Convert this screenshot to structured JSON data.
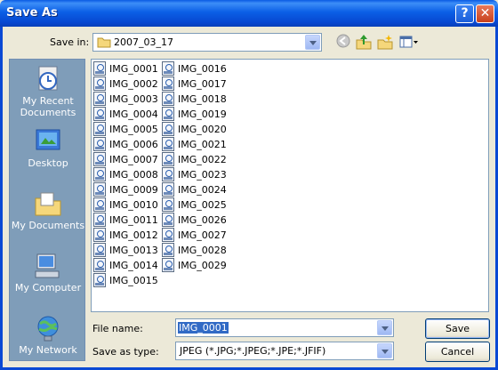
{
  "window": {
    "title": "Save As",
    "help_label": "?",
    "close_label": "✕"
  },
  "save_in": {
    "label": "Save in:",
    "value": "2007_03_17"
  },
  "places": [
    {
      "id": "recent",
      "label": "My Recent Documents"
    },
    {
      "id": "desktop",
      "label": "Desktop"
    },
    {
      "id": "documents",
      "label": "My Documents"
    },
    {
      "id": "computer",
      "label": "My Computer"
    },
    {
      "id": "network",
      "label": "My Network"
    }
  ],
  "files": {
    "column1": [
      "IMG_0001",
      "IMG_0002",
      "IMG_0003",
      "IMG_0004",
      "IMG_0005",
      "IMG_0006",
      "IMG_0007",
      "IMG_0008",
      "IMG_0009",
      "IMG_0010",
      "IMG_0011",
      "IMG_0012",
      "IMG_0013",
      "IMG_0014",
      "IMG_0015"
    ],
    "column2": [
      "IMG_0016",
      "IMG_0017",
      "IMG_0018",
      "IMG_0019",
      "IMG_0020",
      "IMG_0021",
      "IMG_0022",
      "IMG_0023",
      "IMG_0024",
      "IMG_0025",
      "IMG_0026",
      "IMG_0027",
      "IMG_0028",
      "IMG_0029"
    ]
  },
  "file_name": {
    "label": "File name:",
    "value": "IMG_0001"
  },
  "save_as_type": {
    "label": "Save as type:",
    "value": "JPEG (*.JPG;*.JPEG;*.JPE;*.JFIF)"
  },
  "buttons": {
    "save": "Save",
    "cancel": "Cancel"
  },
  "colors": {
    "title_bar": "#0a5be3",
    "places_bar": "#7f9db9",
    "dialog_bg": "#ece9d8",
    "selection": "#316ac5"
  }
}
